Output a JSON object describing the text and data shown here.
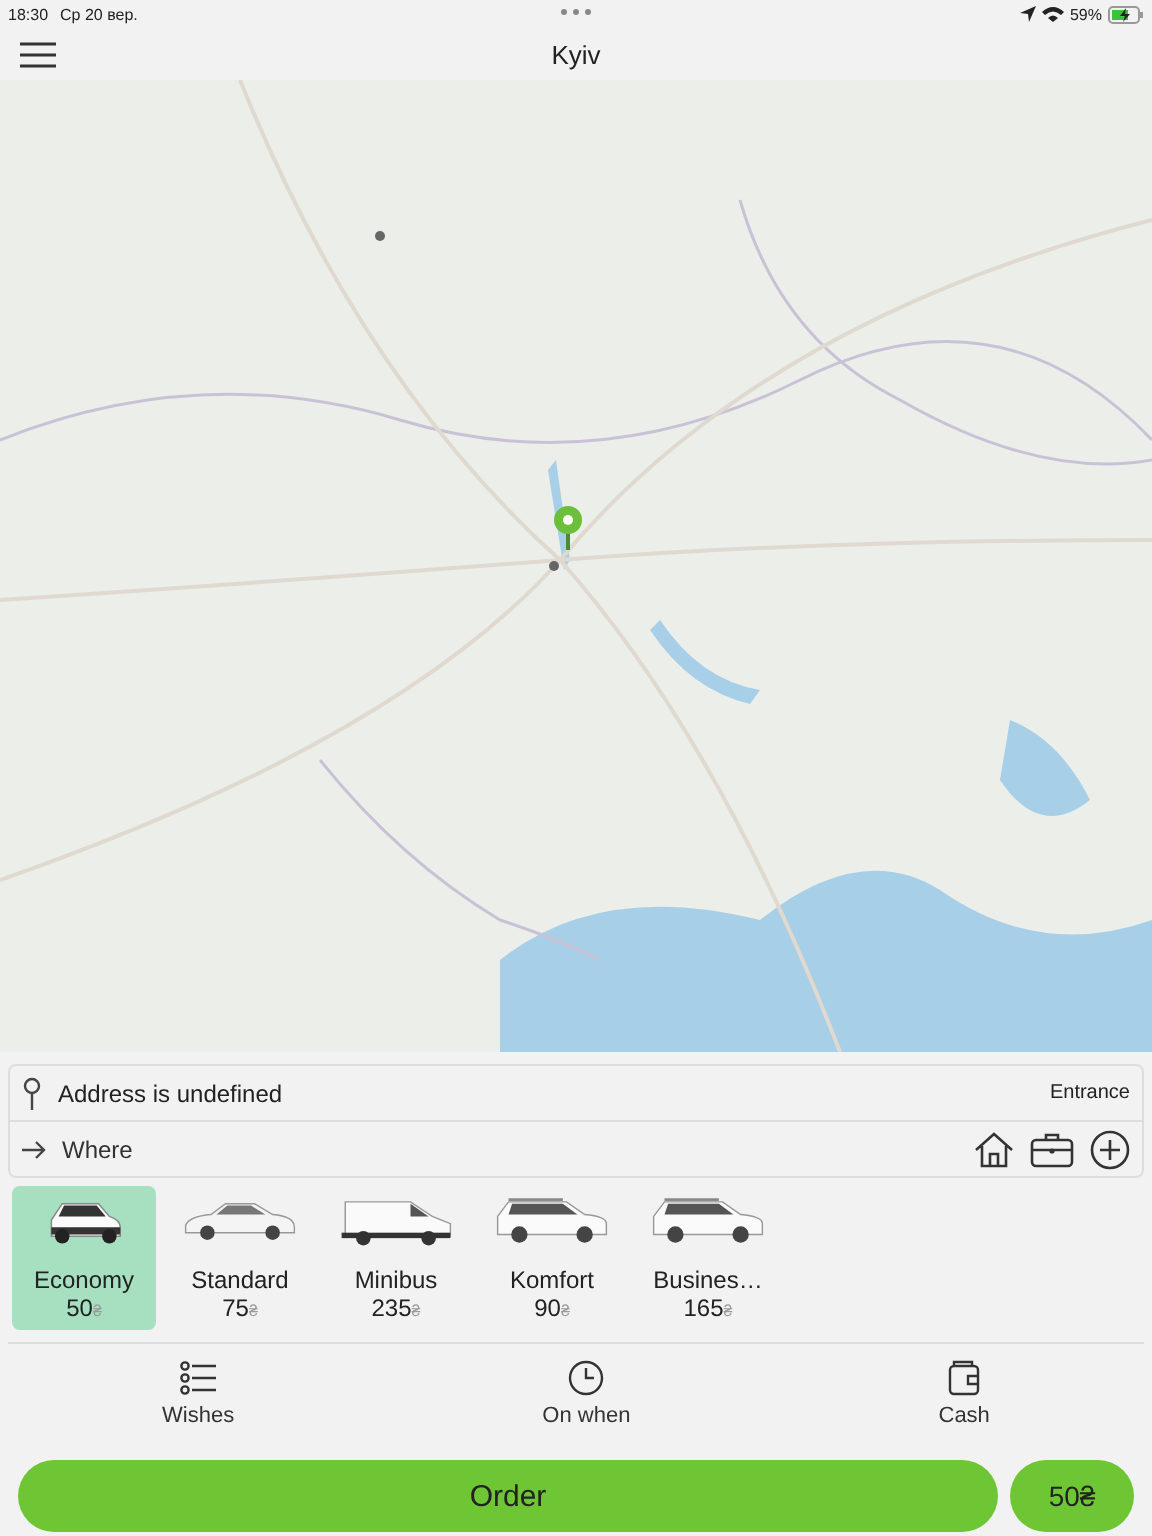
{
  "status_bar": {
    "time": "18:30",
    "date": "Ср 20 вер.",
    "battery": "59%"
  },
  "header": {
    "title": "Kyiv"
  },
  "address": {
    "from": "Address is undefined",
    "entrance": "Entrance",
    "to_placeholder": "Where"
  },
  "tariffs": [
    {
      "name": "Economy",
      "price": "50",
      "currency": "₴",
      "kind": "crossover",
      "selected": true
    },
    {
      "name": "Standard",
      "price": "75",
      "currency": "₴",
      "kind": "sedan",
      "selected": false
    },
    {
      "name": "Minibus",
      "price": "235",
      "currency": "₴",
      "kind": "van",
      "selected": false
    },
    {
      "name": "Komfort",
      "price": "90",
      "currency": "₴",
      "kind": "suv",
      "selected": false
    },
    {
      "name": "Busines…",
      "price": "165",
      "currency": "₴",
      "kind": "suv",
      "selected": false
    }
  ],
  "options": [
    {
      "label": "Wishes",
      "kind": "list"
    },
    {
      "label": "On when",
      "kind": "clock"
    },
    {
      "label": "Cash",
      "kind": "wallet"
    }
  ],
  "order": {
    "label": "Order",
    "price": "50₴"
  }
}
